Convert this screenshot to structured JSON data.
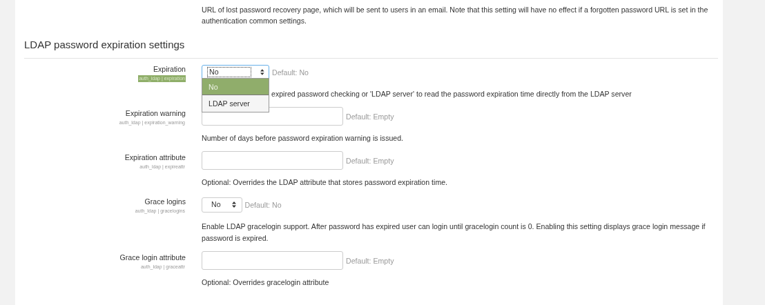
{
  "intro": {
    "description": "URL of lost password recovery page, which will be sent to users in an email. Note that this setting will have no effect if a forgotten password URL is set in the authentication common settings."
  },
  "section": {
    "heading": "LDAP password expiration settings"
  },
  "settings": [
    {
      "kind": "select",
      "label": "Expiration",
      "name": "auth_ldap | expiration",
      "highlighted": true,
      "value": "No",
      "expanded": true,
      "options": [
        {
          "label": "No",
          "selected": true
        },
        {
          "label": "LDAP server",
          "selected": false
        }
      ],
      "default": "Default: No",
      "description": "expired password checking or 'LDAP server' to read the password expiration time directly from the LDAP server"
    },
    {
      "kind": "text",
      "label": "Expiration warning",
      "name": "auth_ldap | expiration_warning",
      "highlighted": false,
      "default": "Default: Empty",
      "description": "Number of days before password expiration warning is issued."
    },
    {
      "kind": "text",
      "label": "Expiration attribute",
      "name": "auth_ldap | expireattr",
      "highlighted": false,
      "default": "Default: Empty",
      "description": "Optional: Overrides the LDAP attribute that stores password expiration time."
    },
    {
      "kind": "select",
      "label": "Grace logins",
      "name": "auth_ldap | gracelogins",
      "highlighted": false,
      "value": "No",
      "expanded": false,
      "default": "Default: No",
      "description": "Enable LDAP gracelogin support. After password has expired user can login until gracelogin count is 0. Enabling this setting displays grace login message if password is expired."
    },
    {
      "kind": "text",
      "label": "Grace login attribute",
      "name": "auth_ldap | graceattr",
      "highlighted": false,
      "default": "Default: Empty",
      "description": "Optional: Overrides gracelogin attribute"
    }
  ]
}
